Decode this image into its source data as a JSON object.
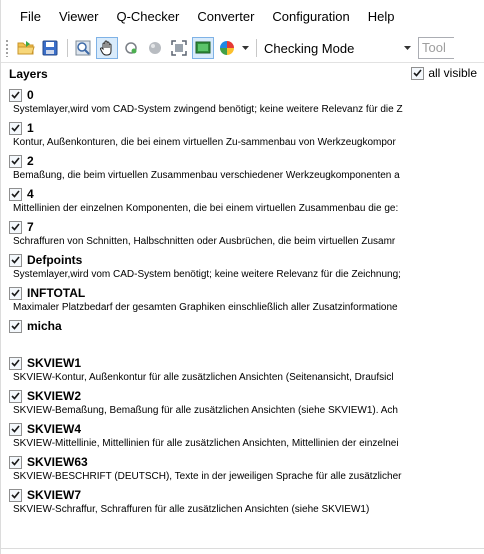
{
  "menu": [
    "File",
    "Viewer",
    "Q-Checker",
    "Converter",
    "Configuration",
    "Help"
  ],
  "toolbar": {
    "icons": [
      "open-folder-icon",
      "save-icon",
      "zoom-icon",
      "pan-hand-icon",
      "rotate-icon",
      "sphere-icon",
      "fit-icon",
      "screen-icon",
      "color-wheel-icon"
    ],
    "mode_label": "Checking Mode",
    "tool_placeholder": "Tool"
  },
  "panel": {
    "title": "Layers",
    "all_visible_label": "all visible"
  },
  "layers": [
    {
      "name": "0",
      "desc": "Systemlayer,wird vom CAD-System zwingend benötigt; keine weitere Relevanz für die Z",
      "checked": true
    },
    {
      "name": "1",
      "desc": "Kontur, Außenkonturen, die bei einem virtuellen Zu-sammenbau von Werkzeugkompor",
      "checked": true
    },
    {
      "name": "2",
      "desc": "Bemaßung, die beim virtuellen Zusammenbau verschiedener Werkzeugkomponenten a",
      "checked": true
    },
    {
      "name": "4",
      "desc": "Mittellinien der einzelnen Komponenten, die bei einem virtuellen Zusammenbau die ge:",
      "checked": true
    },
    {
      "name": "7",
      "desc": "Schraffuren von Schnitten, Halbschnitten oder Ausbrüchen, die beim virtuellen Zusamr",
      "checked": true
    },
    {
      "name": "Defpoints",
      "desc": "Systemlayer,wird vom CAD-System benötigt; keine weitere Relevanz für die Zeichnung;",
      "checked": true
    },
    {
      "name": "INFTOTAL",
      "desc": "Maximaler Platzbedarf der gesamten Graphiken einschließlich aller Zusatzinformatione",
      "checked": true
    },
    {
      "name": "micha",
      "desc": "",
      "checked": true
    },
    {
      "name": "SKVIEW1",
      "desc": "SKVIEW-Kontur, Außenkontur für alle zusätzlichen Ansichten (Seitenansicht, Draufsicl",
      "checked": true
    },
    {
      "name": "SKVIEW2",
      "desc": "SKVIEW-Bemaßung, Bemaßung für alle zusätzlichen Ansichten (siehe SKVIEW1). Ach",
      "checked": true
    },
    {
      "name": "SKVIEW4",
      "desc": "SKVIEW-Mittellinie, Mittellinien für alle zusätzlichen Ansichten, Mittellinien der einzelnei",
      "checked": true
    },
    {
      "name": "SKVIEW63",
      "desc": "SKVIEW-BESCHRIFT (DEUTSCH), Texte in der jeweiligen Sprache für alle zusätzlicher",
      "checked": true
    },
    {
      "name": "SKVIEW7",
      "desc": "SKVIEW-Schraffur, Schraffuren für alle zusätzlichen Ansichten (siehe SKVIEW1)",
      "checked": true
    }
  ]
}
